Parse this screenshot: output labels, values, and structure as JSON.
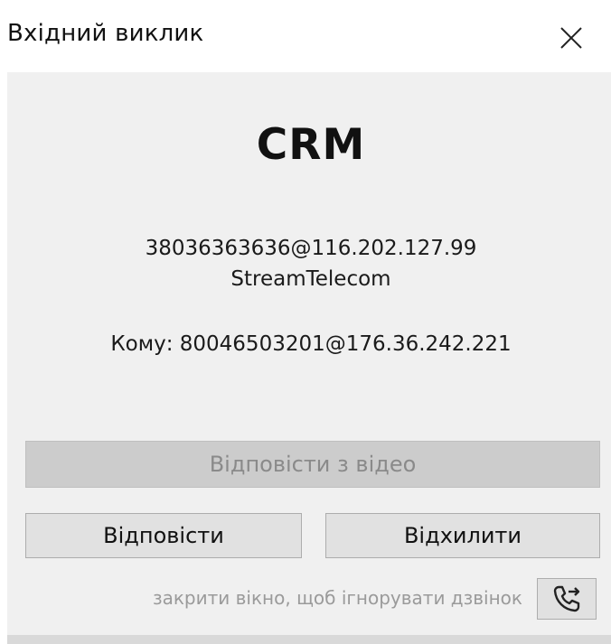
{
  "window": {
    "title": "Вхідний виклик"
  },
  "call": {
    "caller_name": "CRM",
    "from_address": "38036363636@116.202.127.99",
    "provider": "StreamTelecom",
    "to_address": "Кому: 80046503201@176.36.242.221"
  },
  "actions": {
    "answer_video_label": "Відповісти з відео",
    "answer_video_enabled": false,
    "answer_label": "Відповісти",
    "decline_label": "Відхилити",
    "hint": "закрити вікно, щоб ігнорувати дзвінок",
    "transfer_icon": "phone-forward-icon"
  },
  "colors": {
    "panel_background": "#f0f0f0",
    "button_background": "#e1e1e1",
    "disabled_button_background": "#cccccc"
  }
}
